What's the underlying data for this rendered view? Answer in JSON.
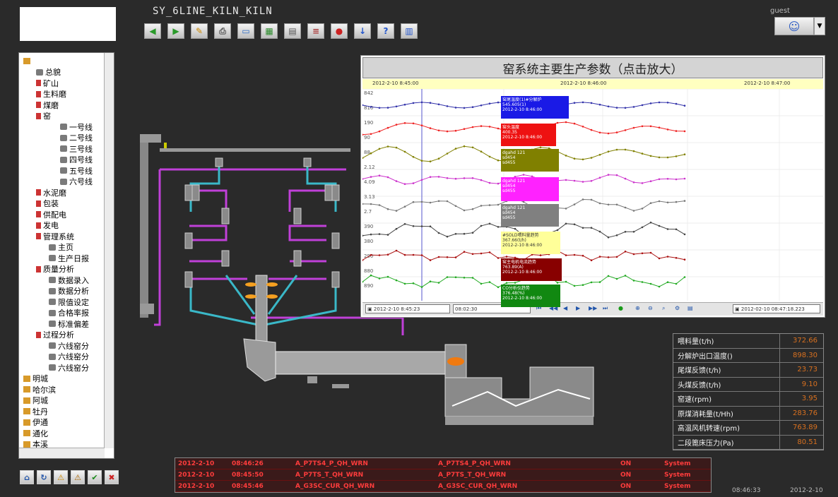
{
  "app": {
    "title": "SY_6LINE_KILN_KILN"
  },
  "user": {
    "name": "guest"
  },
  "toolbar": {
    "buttons": [
      {
        "name": "back-icon",
        "glyph": "◀",
        "color": "#2a9a2a"
      },
      {
        "name": "forward-icon",
        "glyph": "▶",
        "color": "#2a9a2a"
      },
      {
        "name": "edit-icon",
        "glyph": "✎",
        "color": "#cc8800"
      },
      {
        "name": "print-icon",
        "glyph": "⎙",
        "color": "#555555"
      },
      {
        "name": "window-icon",
        "glyph": "▭",
        "color": "#2a6ac4"
      },
      {
        "name": "chart-icon",
        "glyph": "▦",
        "color": "#2a8a2a"
      },
      {
        "name": "grid-icon",
        "glyph": "▤",
        "color": "#555555"
      },
      {
        "name": "report-icon",
        "glyph": "≡",
        "color": "#aa3a3a"
      },
      {
        "name": "stop-icon",
        "glyph": "●",
        "color": "#cc2222"
      },
      {
        "name": "download-icon",
        "glyph": "↓",
        "color": "#2255cc"
      },
      {
        "name": "help-icon",
        "glyph": "?",
        "color": "#2255cc"
      },
      {
        "name": "bar-chart-icon",
        "glyph": "▥",
        "color": "#2255cc"
      }
    ]
  },
  "tree": {
    "items": [
      {
        "label": "",
        "level": "l1",
        "icon": "ic-box"
      },
      {
        "label": "总貌",
        "level": "l2",
        "icon": "ic-gear"
      },
      {
        "label": "矿山",
        "level": "l2",
        "icon": "ic-tool"
      },
      {
        "label": "生料磨",
        "level": "l2",
        "icon": "ic-tool"
      },
      {
        "label": "煤磨",
        "level": "l2",
        "icon": "ic-tool"
      },
      {
        "label": "窑",
        "level": "l2",
        "icon": "ic-tool"
      },
      {
        "label": "一号线",
        "level": "l4",
        "icon": "ic-gear"
      },
      {
        "label": "二号线",
        "level": "l4",
        "icon": "ic-gear"
      },
      {
        "label": "三号线",
        "level": "l4",
        "icon": "ic-gear"
      },
      {
        "label": "四号线",
        "level": "l4",
        "icon": "ic-gear"
      },
      {
        "label": "五号线",
        "level": "l4",
        "icon": "ic-gear"
      },
      {
        "label": "六号线",
        "level": "l4",
        "icon": "ic-gear"
      },
      {
        "label": "水泥磨",
        "level": "l2",
        "icon": "ic-tool"
      },
      {
        "label": "包装",
        "level": "l2",
        "icon": "ic-tool"
      },
      {
        "label": "供配电",
        "level": "l2",
        "icon": "ic-tool"
      },
      {
        "label": "发电",
        "level": "l2",
        "icon": "ic-tool"
      },
      {
        "label": "管理系统",
        "level": "l2",
        "icon": "ic-tool"
      },
      {
        "label": "主页",
        "level": "l3",
        "icon": "ic-gear"
      },
      {
        "label": "生产日报",
        "level": "l3",
        "icon": "ic-gear"
      },
      {
        "label": "质量分析",
        "level": "l2",
        "icon": "ic-tool"
      },
      {
        "label": "数据录入",
        "level": "l3",
        "icon": "ic-gear"
      },
      {
        "label": "数据分析",
        "level": "l3",
        "icon": "ic-gear"
      },
      {
        "label": "限值设定",
        "level": "l3",
        "icon": "ic-gear"
      },
      {
        "label": "合格率报",
        "level": "l3",
        "icon": "ic-gear"
      },
      {
        "label": "标准偏差",
        "level": "l3",
        "icon": "ic-gear"
      },
      {
        "label": "过程分析",
        "level": "l2",
        "icon": "ic-tool"
      },
      {
        "label": "六线窑分",
        "level": "l3",
        "icon": "ic-gear"
      },
      {
        "label": "六线窑分",
        "level": "l3",
        "icon": "ic-gear"
      },
      {
        "label": "六线窑分",
        "level": "l3",
        "icon": "ic-gear"
      },
      {
        "label": "明城",
        "level": "l1",
        "icon": "ic-box"
      },
      {
        "label": "哈尔滨",
        "level": "l1",
        "icon": "ic-box"
      },
      {
        "label": "阿城",
        "level": "l1",
        "icon": "ic-box"
      },
      {
        "label": "牡丹",
        "level": "l1",
        "icon": "ic-box"
      },
      {
        "label": "伊通",
        "level": "l1",
        "icon": "ic-box"
      },
      {
        "label": "通化",
        "level": "l1",
        "icon": "ic-box"
      },
      {
        "label": "本溪",
        "level": "l1",
        "icon": "ic-box"
      }
    ]
  },
  "trend": {
    "title": "窑系统主要生产参数（点击放大）",
    "times": [
      "2012-2-10 8:45:00",
      "2012-2-10 8:46:00",
      "2012-2-10 8:47:00"
    ],
    "yticks": [
      "842",
      "810",
      "190",
      "90",
      "88",
      "2.12",
      "4.09",
      "3.13",
      "2.7",
      "390",
      "380",
      "290",
      "880",
      "890"
    ],
    "tags": [
      {
        "lines": [
          "窑尾温度(1)#分解炉",
          "545.605(1)",
          "2012-2-10 8:46:00"
        ],
        "bg": "#1a1ae6",
        "fg": "#ffffff"
      },
      {
        "lines": [
          "窑头温度",
          "400.35",
          "2012-2-10 8:46:00"
        ],
        "bg": "#ee1111",
        "fg": "#ffffff"
      },
      {
        "lines": [
          "dgahd 121",
          "sd454",
          "sd455"
        ],
        "bg": "#808000",
        "fg": "#ffffff"
      },
      {
        "lines": [
          "dgahd 121",
          "sd454",
          "sd455"
        ],
        "bg": "#ff22ff",
        "fg": "#ffffff"
      },
      {
        "lines": [
          "dgahd 121",
          "sd454",
          "sd455"
        ],
        "bg": "#808080",
        "fg": "#ffffff"
      },
      {
        "lines": [
          "#SOLD喂料量趋势",
          "367.66(t/h)",
          "2012-2-10 8:46:00"
        ],
        "bg": "#ffff99",
        "fg": "#333333"
      },
      {
        "lines": [
          "窑主电机电流趋势",
          "763.89(A)",
          "2012-2-10 8:46:00"
        ],
        "bg": "#880000",
        "fg": "#ffffff"
      },
      {
        "lines": [
          "CO分析仪趋势",
          "376.48(%)",
          "2012-2-10 8:46:00"
        ],
        "bg": "#118811",
        "fg": "#ffffff"
      }
    ],
    "bar_start": "2012-2-10 8:45:23",
    "bar_span": "08:02:30",
    "bar_end": "2012-02-10 08:47:18.223"
  },
  "params": {
    "rows": [
      {
        "label": "喂料量(t/h)",
        "value": "372.66"
      },
      {
        "label": "分解炉出口温度()",
        "value": "898.30"
      },
      {
        "label": "尾煤反馈(t/h)",
        "value": "23.73"
      },
      {
        "label": "头煤反馈(t/h)",
        "value": "9.10"
      },
      {
        "label": "窑速(rpm)",
        "value": "3.95"
      },
      {
        "label": "原煤消耗量(t/Hh)",
        "value": "283.76"
      },
      {
        "label": "高温风机转速(rpm)",
        "value": "763.89"
      },
      {
        "label": "二段篦床压力(Pa)",
        "value": "80.51"
      }
    ]
  },
  "alarms": {
    "rows": [
      {
        "date": "2012-2-10",
        "time": "08:46:26",
        "tag1": "A_P7TS4_P_QH_WRN",
        "tag2": "A_P7TS4_P_QH_WRN",
        "state": "ON",
        "user": "System"
      },
      {
        "date": "2012-2-10",
        "time": "08:45:50",
        "tag1": "A_P7TS_T_QH_WRN",
        "tag2": "A_P7TS_T_QH_WRN",
        "state": "ON",
        "user": "System"
      },
      {
        "date": "2012-2-10",
        "time": "08:45:46",
        "tag1": "A_G3SC_CUR_QH_WRN",
        "tag2": "A_G3SC_CUR_QH_WRN",
        "state": "ON",
        "user": "System"
      }
    ]
  },
  "bottom_buttons": [
    {
      "name": "home-icon",
      "glyph": "⌂",
      "color": "#2255aa"
    },
    {
      "name": "refresh-icon",
      "glyph": "↻",
      "color": "#2255aa"
    },
    {
      "name": "warning-icon",
      "glyph": "⚠",
      "color": "#cc8800"
    },
    {
      "name": "warning-list-icon",
      "glyph": "⚠",
      "color": "#aa6600"
    },
    {
      "name": "check-icon",
      "glyph": "✔",
      "color": "#1a8a1a"
    },
    {
      "name": "close-icon",
      "glyph": "✖",
      "color": "#cc2222"
    }
  ],
  "status": {
    "time": "08:46:33",
    "date": "2012-2-10"
  },
  "colors": {
    "background": "#2a2a2a",
    "pipe": "#c040d8",
    "cyan": "#3ab8c8",
    "value": "#d8701f",
    "alarm": "#ff3c3c"
  }
}
